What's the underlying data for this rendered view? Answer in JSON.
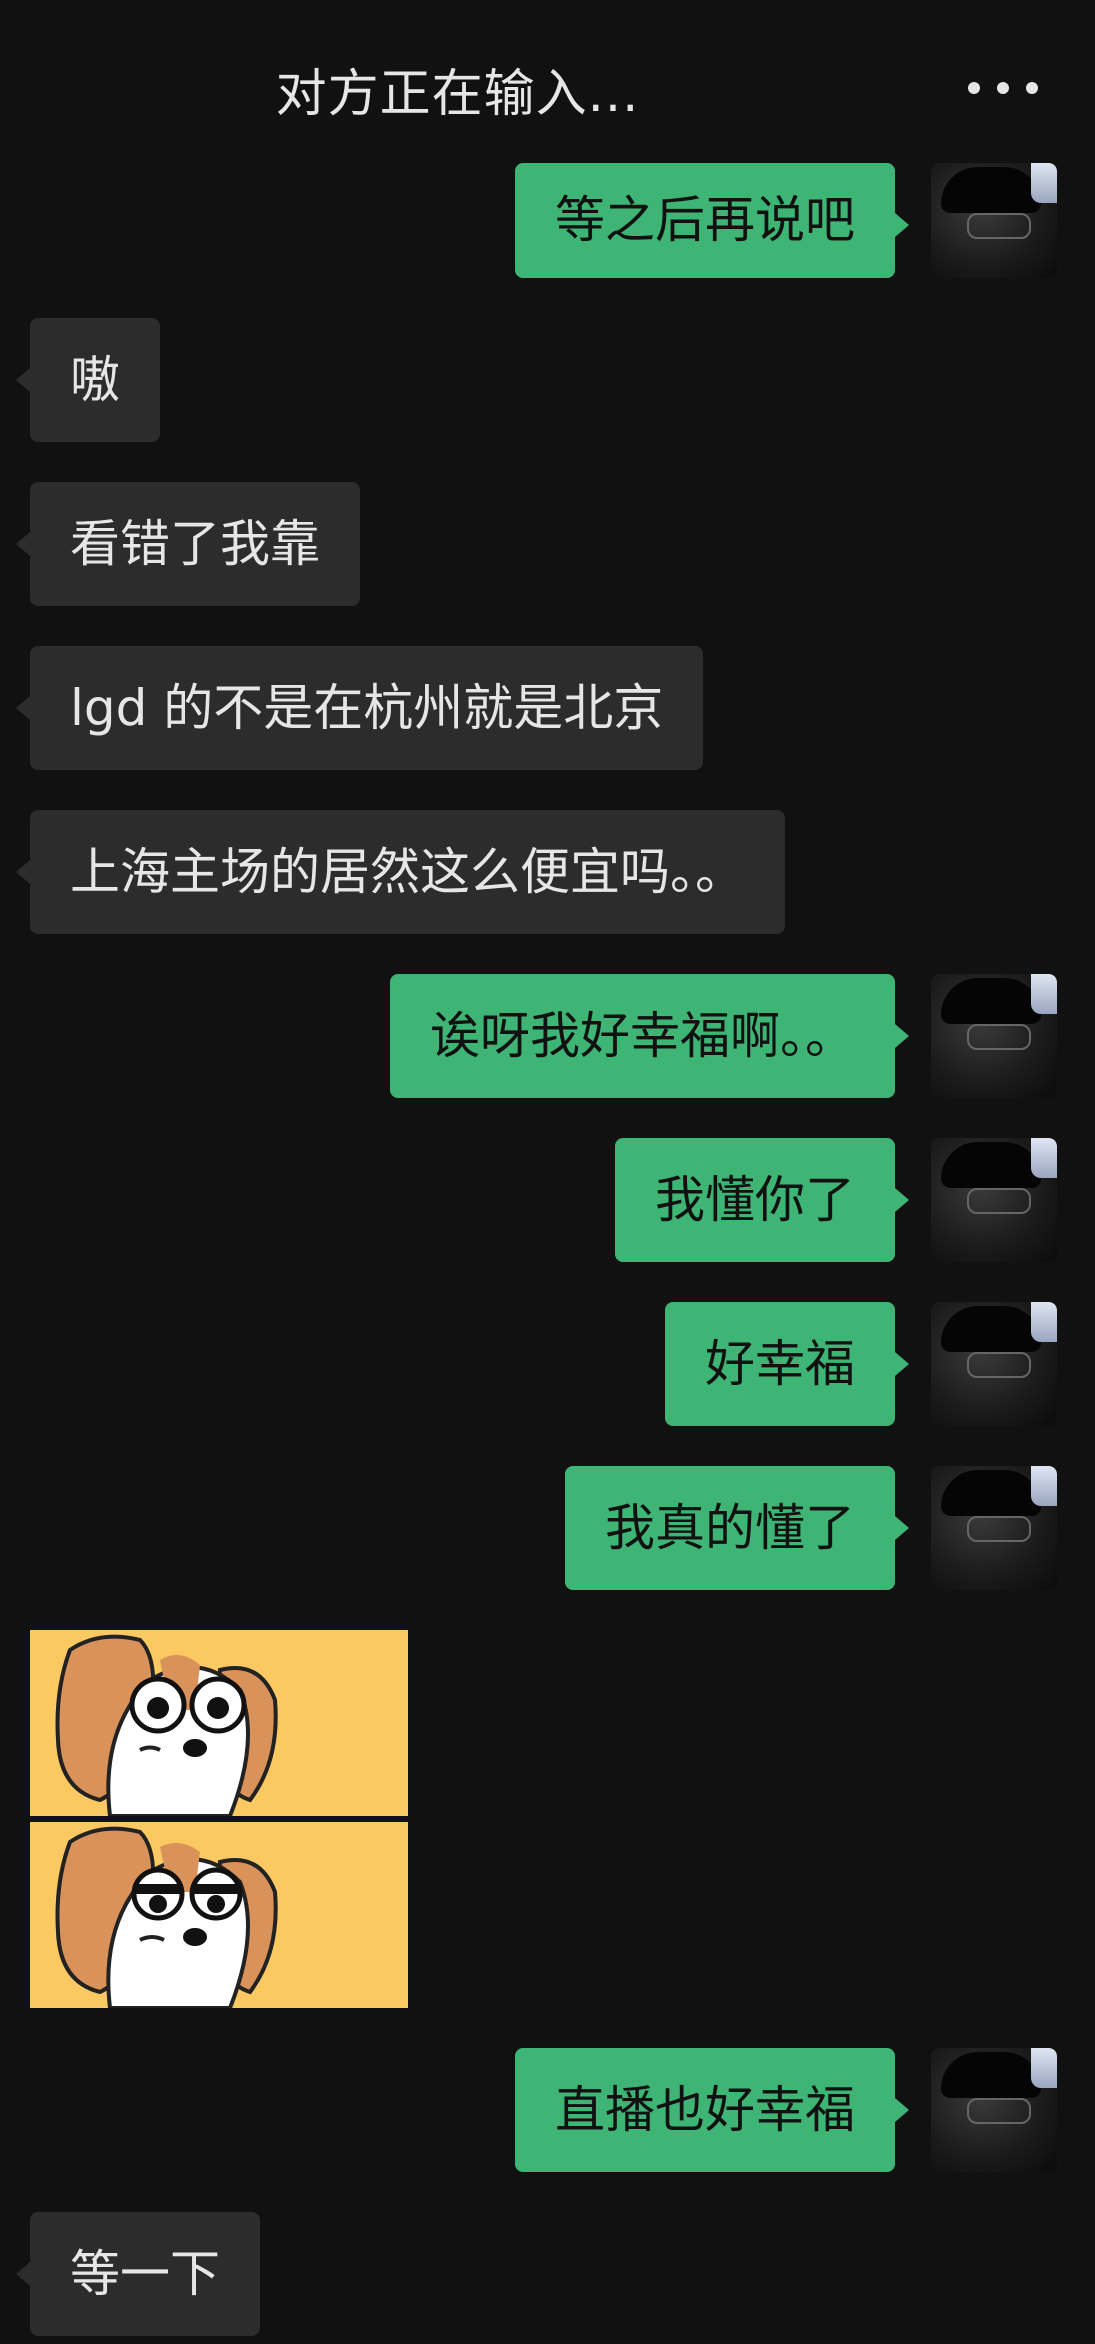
{
  "header": {
    "title": "对方正在输入...",
    "more_icon": "more-dots-icon"
  },
  "colors": {
    "background": "#111111",
    "incoming_bubble": "#2c2c2c",
    "outgoing_bubble": "#3eb575",
    "sticker_bg": "#fbc962"
  },
  "messages": [
    {
      "side": "out",
      "text": "等之后再说吧"
    },
    {
      "side": "in",
      "text": "嗷"
    },
    {
      "side": "in",
      "text": "看错了我靠"
    },
    {
      "side": "in",
      "text": "lgd 的不是在杭州就是北京"
    },
    {
      "side": "in",
      "text": "上海主场的居然这么便宜吗。。"
    },
    {
      "side": "out",
      "text": "诶呀我好幸福啊。。"
    },
    {
      "side": "out",
      "text": "我懂你了"
    },
    {
      "side": "out",
      "text": "好幸福"
    },
    {
      "side": "out",
      "text": "我真的懂了"
    },
    {
      "side": "in",
      "type": "sticker",
      "icon": "dog-meme-sticker"
    },
    {
      "side": "out",
      "text": "直播也好幸福"
    },
    {
      "side": "in",
      "text": "等一下"
    }
  ]
}
